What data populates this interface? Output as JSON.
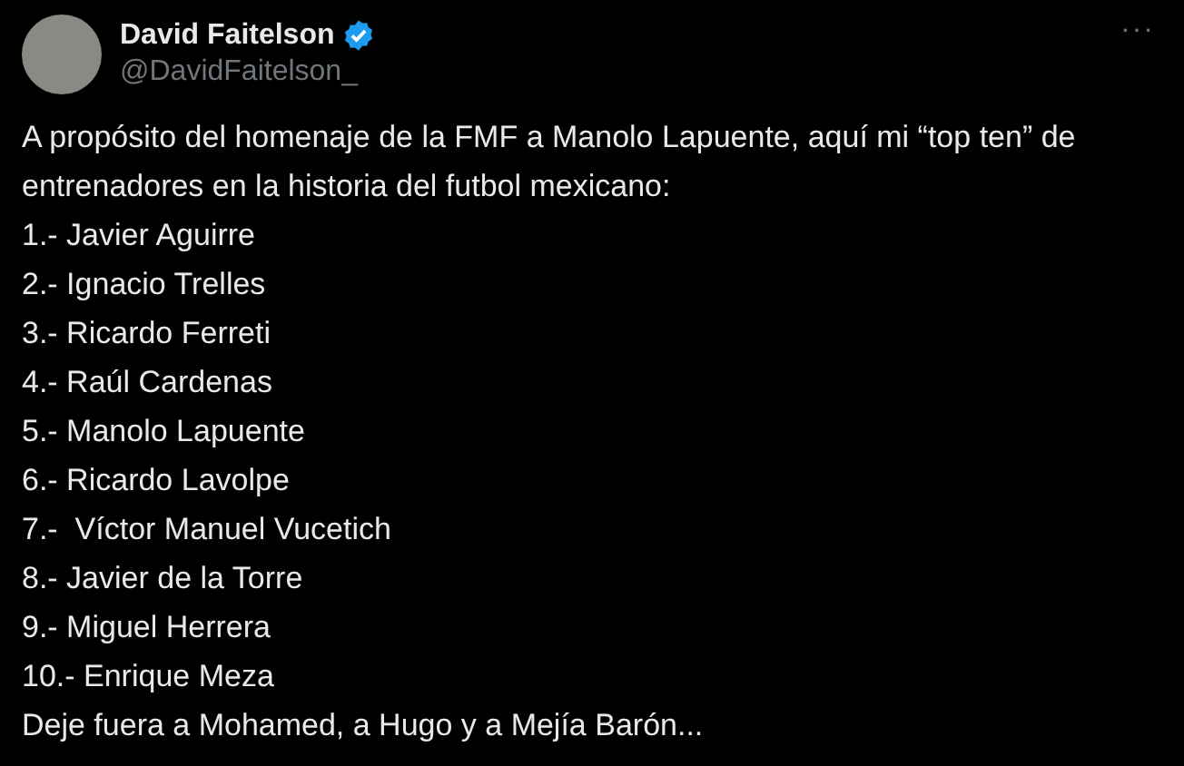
{
  "author": {
    "name": "David Faitelson",
    "verified": true,
    "handle": "@DavidFaitelson_"
  },
  "menu": "···",
  "text": {
    "intro": "A propósito del homenaje de la FMF a Manolo Lapuente, aquí mi “top ten” de entrenadores en la historia del futbol mexicano:",
    "items": [
      "1.- Javier Aguirre",
      "2.- Ignacio Trelles",
      "3.- Ricardo Ferreti",
      "4.- Raúl Cardenas",
      "5.- Manolo Lapuente",
      "6.- Ricardo Lavolpe",
      "7.-  Víctor Manuel Vucetich",
      "8.- Javier de la Torre",
      "9.- Miguel Herrera",
      "10.- Enrique Meza"
    ],
    "outro": "Deje fuera a Mohamed, a Hugo y a Mejía Barón..."
  }
}
